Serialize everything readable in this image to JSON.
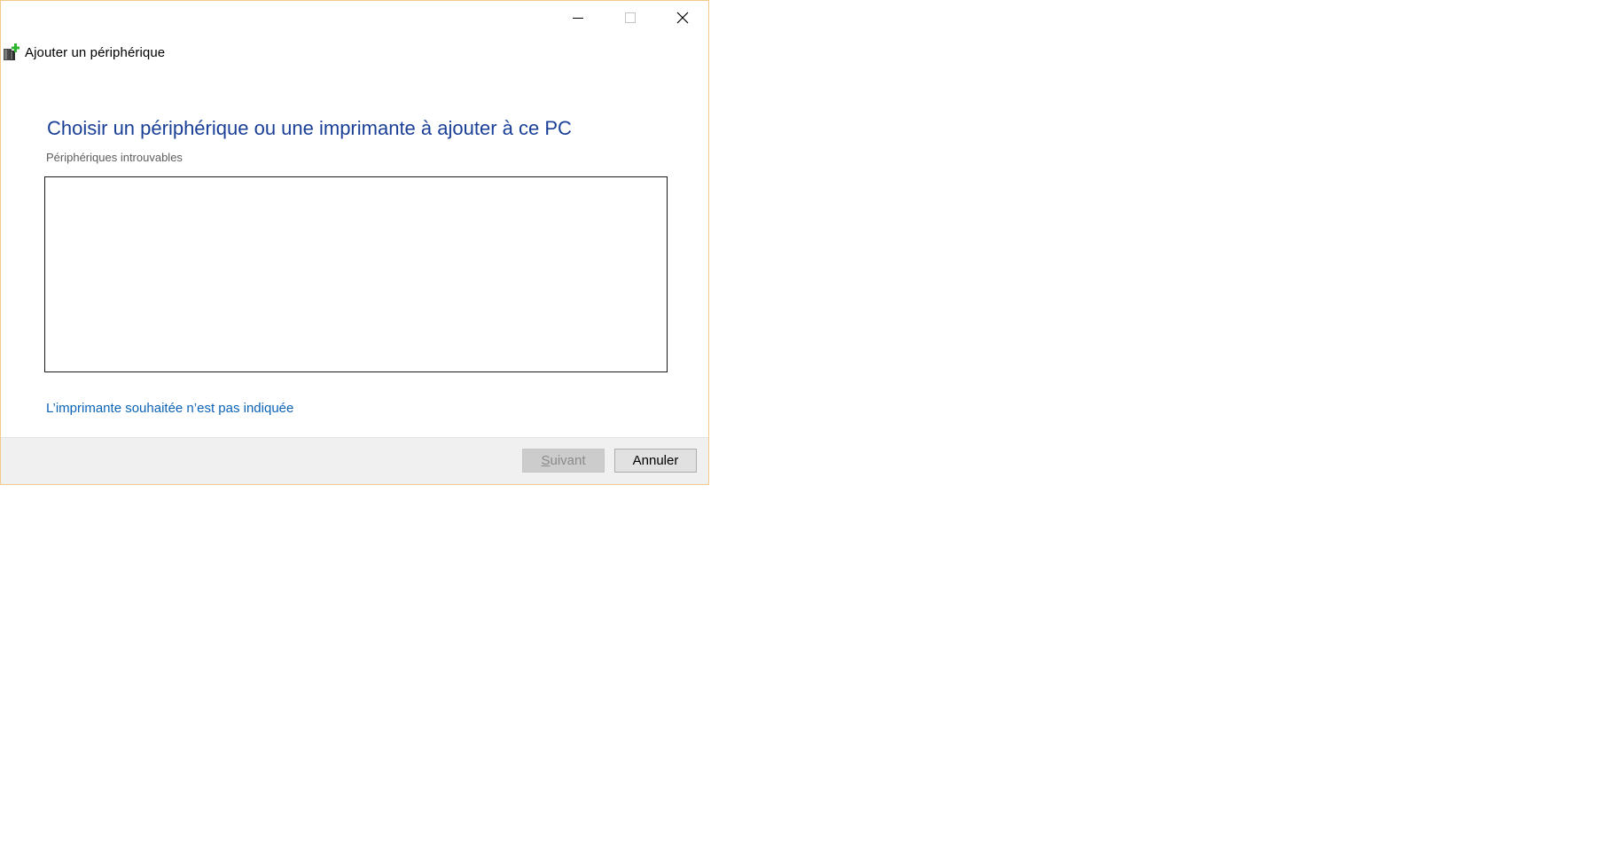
{
  "window": {
    "title": "Ajouter un périphérique",
    "accent_border_color": "#f2c98a"
  },
  "caption_buttons": {
    "minimize_icon": "minimize-icon",
    "maximize_icon": "maximize-icon",
    "close_icon": "close-icon"
  },
  "main": {
    "heading": "Choisir un périphérique ou une imprimante à ajouter à ce PC",
    "subheading": "Périphériques introuvables",
    "device_list_items": [],
    "printer_link": "L’imprimante souhaitée n’est pas indiquée"
  },
  "footer": {
    "next_label": "Suivant",
    "next_enabled": false,
    "cancel_label": "Annuler"
  },
  "colors": {
    "heading": "#1a3f97",
    "link": "#0b63b8",
    "footer_bg": "#f0f0f0"
  }
}
